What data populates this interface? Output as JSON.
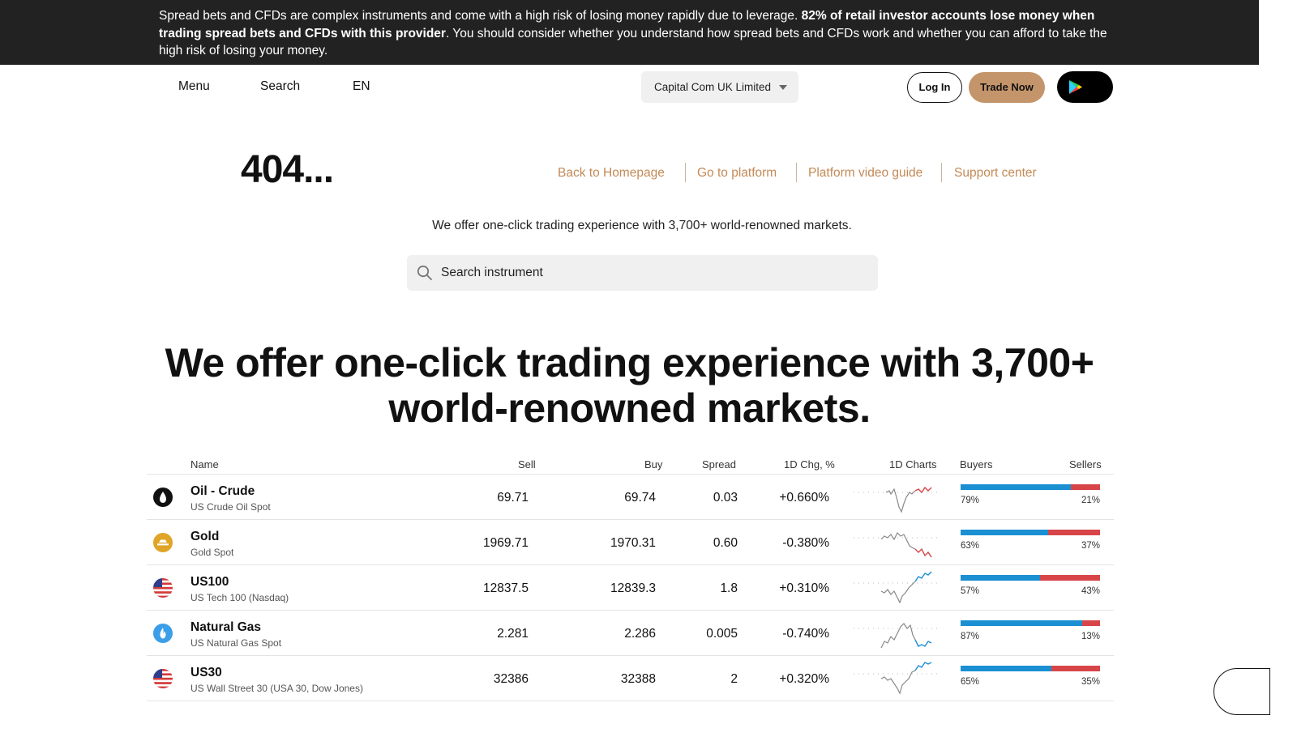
{
  "risk_warning": {
    "part1": "Spread bets and CFDs are complex instruments and come with a high risk of losing money rapidly due to leverage. ",
    "bold": "82% of retail investor accounts lose money when trading spread bets and CFDs with this provider",
    "part2": ". You should consider whether you understand how spread bets and CFDs work and whether you can afford to take the high risk of losing your money."
  },
  "header": {
    "menu": "Menu",
    "search": "Search",
    "language": "EN",
    "entity": "Capital Com UK Limited",
    "login": "Log In",
    "trade_now": "Trade Now"
  },
  "error_title": "404...",
  "quick_links": [
    "Back to Homepage",
    "Go to platform",
    "Platform video guide",
    "Support center"
  ],
  "offer_small": "We offer one-click trading experience with 3,700+ world-renowned markets.",
  "search": {
    "placeholder": "Search instrument"
  },
  "headline": {
    "line1": "We offer one-click trading experience with 3,700+",
    "line2": "world-renowned markets."
  },
  "table": {
    "columns": {
      "name": "Name",
      "sell": "Sell",
      "buy": "Buy",
      "spread": "Spread",
      "change": "1D Chg, %",
      "charts": "1D Charts",
      "buyers": "Buyers",
      "sellers": "Sellers"
    },
    "rows": [
      {
        "icon": "oil-drop-icon",
        "name": "Oil - Crude",
        "sub": "US Crude Oil Spot",
        "sell": "69.71",
        "buy": "69.74",
        "spread": "0.03",
        "change": "+0.660%",
        "buyers": "79%",
        "sellers": "21%",
        "buyers_fraction": 0.79,
        "trend": "red"
      },
      {
        "icon": "gold-bars-icon",
        "name": "Gold",
        "sub": "Gold Spot",
        "sell": "1969.71",
        "buy": "1970.31",
        "spread": "0.60",
        "change": "-0.380%",
        "buyers": "63%",
        "sellers": "37%",
        "buyers_fraction": 0.63,
        "trend": "red"
      },
      {
        "icon": "us-flag-icon",
        "name": "US100",
        "sub": "US Tech 100 (Nasdaq)",
        "sell": "12837.5",
        "buy": "12839.3",
        "spread": "1.8",
        "change": "+0.310%",
        "buyers": "57%",
        "sellers": "43%",
        "buyers_fraction": 0.57,
        "trend": "blue"
      },
      {
        "icon": "gas-flame-icon",
        "name": "Natural Gas",
        "sub": "US Natural Gas Spot",
        "sell": "2.281",
        "buy": "2.286",
        "spread": "0.005",
        "change": "-0.740%",
        "buyers": "87%",
        "sellers": "13%",
        "buyers_fraction": 0.87,
        "trend": "blue"
      },
      {
        "icon": "us-flag-icon",
        "name": "US30",
        "sub": "US Wall Street 30 (USA 30, Dow Jones)",
        "sell": "32386",
        "buy": "32388",
        "spread": "2",
        "change": "+0.320%",
        "buyers": "65%",
        "sellers": "35%",
        "buyers_fraction": 0.65,
        "trend": "blue"
      }
    ]
  },
  "colors": {
    "accent": "#c4956a",
    "link": "#c38a57",
    "buyers": "#1a8fd2",
    "sellers": "#d74548",
    "banner": "#222222"
  }
}
